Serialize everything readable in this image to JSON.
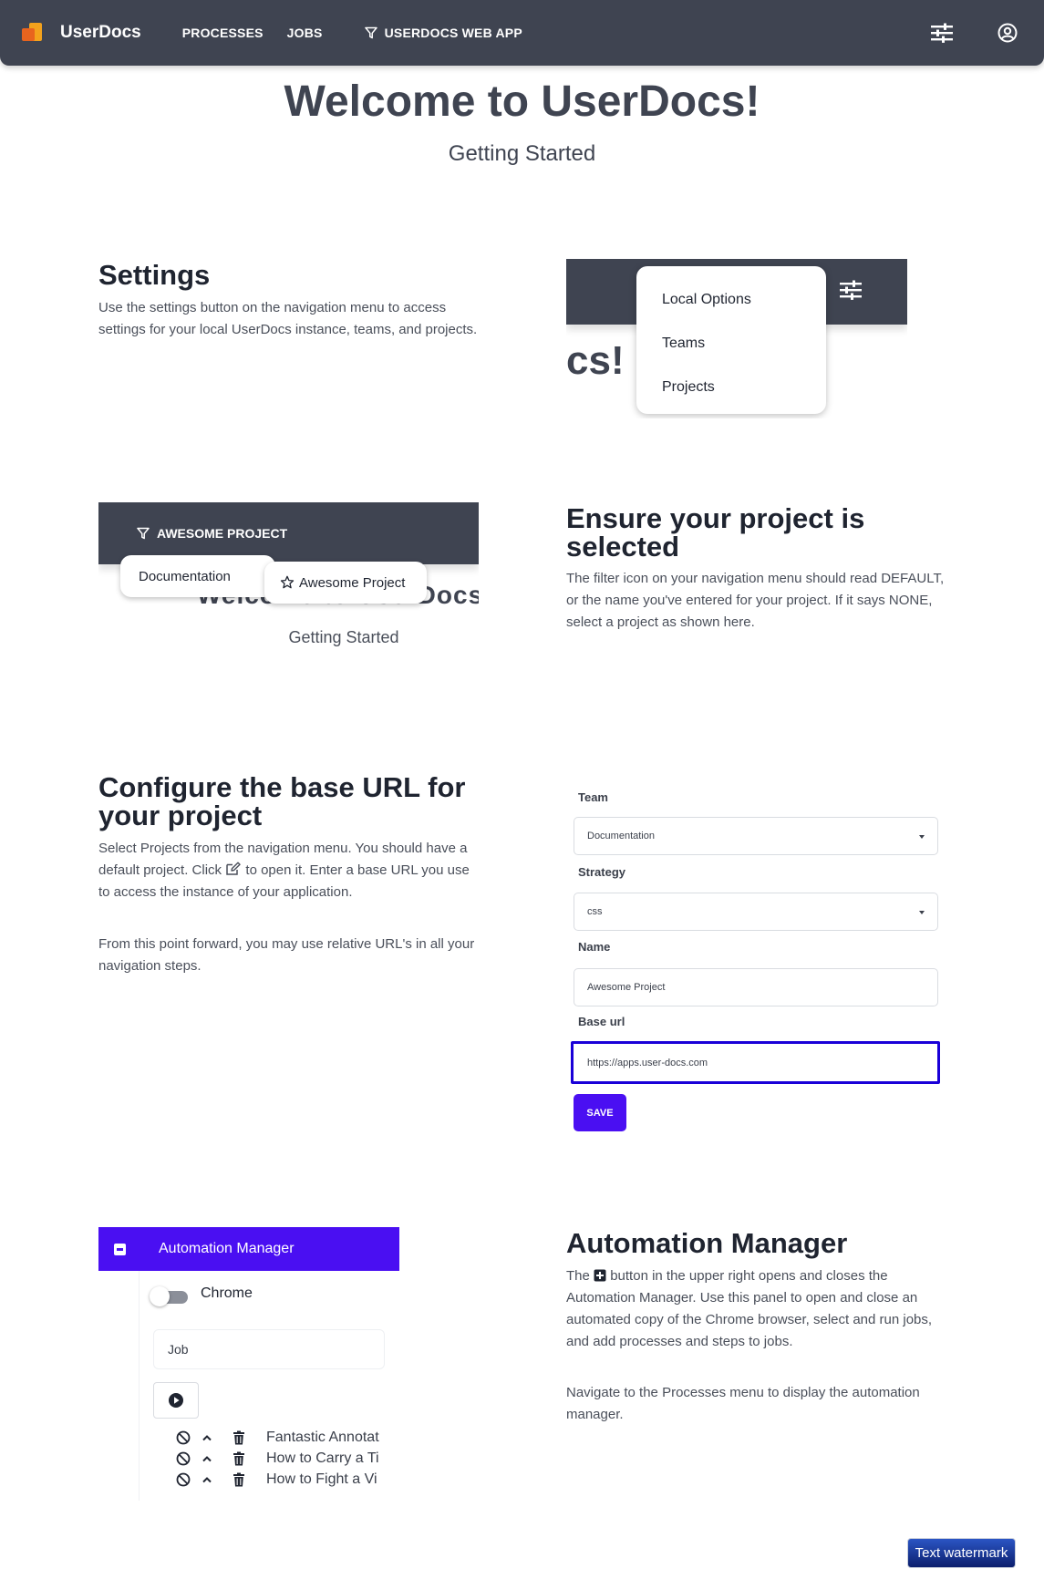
{
  "navbar": {
    "brand": "UserDocs",
    "items": [
      "PROCESSES",
      "JOBS"
    ],
    "project": "USERDOCS WEB APP",
    "icons": [
      "settings-icon",
      "account-icon"
    ]
  },
  "header": {
    "title": "Welcome to UserDocs!",
    "subtitle": "Getting Started"
  },
  "settings": {
    "title": "Settings",
    "body": "Use the settings button on the navigation menu to access settings for your local UserDocs instance, teams, and projects.",
    "illustration": {
      "partial_title": "cs!",
      "menu": [
        "Local Options",
        "Teams",
        "Projects"
      ]
    }
  },
  "project": {
    "title_line1": "Ensure your project is",
    "title_line2": "selected",
    "body": "The filter icon on your navigation menu should read DEFAULT, or the name you've entered for your project. If it says NONE, select a project as shown here.",
    "illustration": {
      "project_label": "AWESOME PROJECT",
      "team_option": "Documentation",
      "project_option": "Awesome Project",
      "behind_text": "Welcome to UserDocs",
      "subtitle": "Getting Started"
    }
  },
  "base_url": {
    "title_line1": "Configure the base URL for",
    "title_line2": "your project",
    "body_before": "Select Projects from the navigation menu. You should have a default project. Click",
    "body_after": "to open it. Enter a base URL you use to access the instance of your application.",
    "body2": "From this point forward, you may use relative URL's in all your navigation steps.",
    "form": {
      "team_label": "Team",
      "team_value": "Documentation",
      "strategy_label": "Strategy",
      "strategy_value": "css",
      "name_label": "Name",
      "name_value": "Awesome Project",
      "base_url_label": "Base url",
      "base_url_value": "https://apps.user-docs.com",
      "save_label": "SAVE"
    }
  },
  "automation": {
    "title": "Automation Manager",
    "body_before": "The",
    "body_after": "button in the upper right opens and closes the Automation Manager. Use this panel to open and close an automated copy of the Chrome browser, select and run jobs, and add processes and steps to jobs.",
    "body2": "Navigate to the Processes menu to display the automation manager.",
    "panel": {
      "header": "Automation Manager",
      "browser_label": "Chrome",
      "browser_enabled": false,
      "job_label": "Job",
      "rows": [
        "Fantastic Annotat",
        "How to Carry a Ti",
        "How to Fight a Vi"
      ]
    }
  },
  "watermark": "Text watermark",
  "colors": {
    "navbar": "#3f4451",
    "accent": "#4a0ff2",
    "focus_border": "#1a00d8"
  }
}
